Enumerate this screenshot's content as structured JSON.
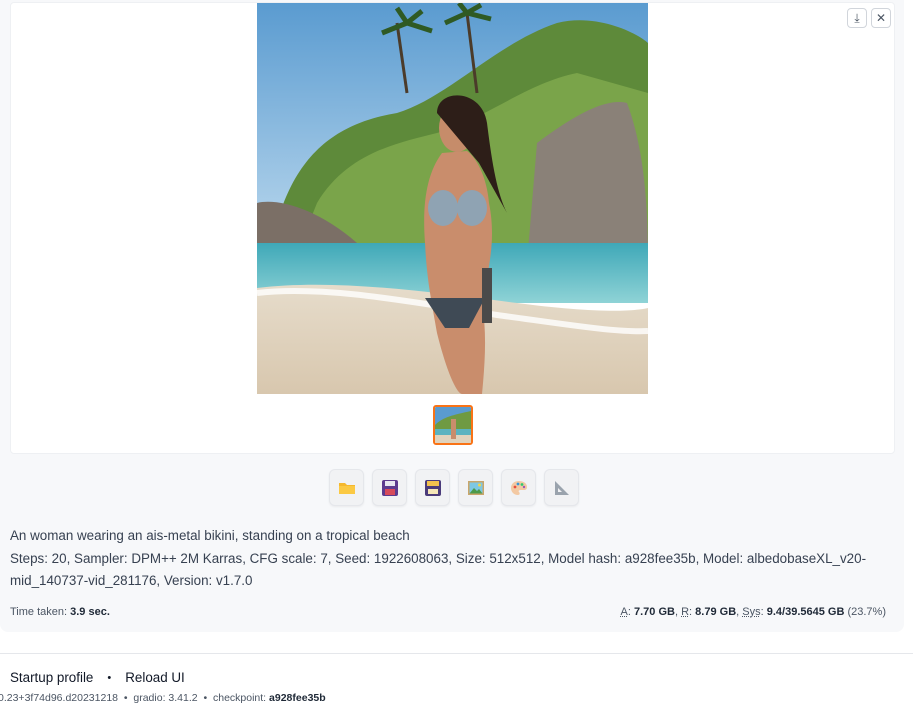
{
  "gallery": {
    "image_alt": "Generated image",
    "download_icon": "download-icon",
    "close_icon": "close-icon",
    "download_glyph": "⤓",
    "close_glyph": "✕"
  },
  "toolbar": {
    "buttons": [
      {
        "name": "open-folder-button",
        "icon": "folder-icon"
      },
      {
        "name": "save-button",
        "icon": "floppy-disk-icon"
      },
      {
        "name": "zip-button",
        "icon": "archive-floppy-icon"
      },
      {
        "name": "send-to-img2img-button",
        "icon": "picture-icon"
      },
      {
        "name": "send-to-inpaint-button",
        "icon": "palette-icon"
      },
      {
        "name": "send-to-extras-button",
        "icon": "triangle-ruler-icon"
      }
    ]
  },
  "info": {
    "prompt": "An woman wearing an ais-metal bikini, standing on a tropical beach",
    "params": "Steps: 20, Sampler: DPM++ 2M Karras, CFG scale: 7, Seed: 1922608063, Size: 512x512, Model hash: a928fee35b, Model: albedobaseXL_v20-mid_140737-vid_281176, Version: v1.7.0"
  },
  "status": {
    "time_label": "Time taken:",
    "time_value": "3.9 sec.",
    "a_label": "A",
    "a_value": "7.70 GB",
    "r_label": "R",
    "r_value": "8.79 GB",
    "sys_label": "Sys",
    "sys_value": "9.4/39.5645 GB",
    "sys_pct": "(23.7%)"
  },
  "footer": {
    "startup_profile": "Startup profile",
    "separator": "•",
    "reload_ui": "Reload UI",
    "version_text": "0.23+3f74d96.d20231218",
    "gradio_label": "gradio:",
    "gradio_value": "3.41.2",
    "checkpoint_label": "checkpoint:",
    "checkpoint_value": "a928fee35b"
  },
  "colors": {
    "accent_orange": "#f97316",
    "panel_bg": "#f7f8fa"
  }
}
